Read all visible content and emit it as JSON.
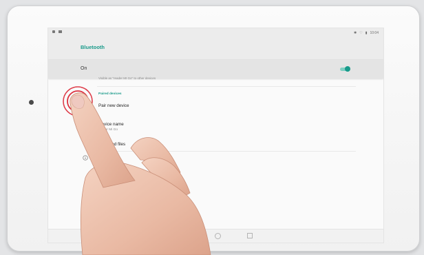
{
  "statusbar": {
    "time": "10:04",
    "status_icons": [
      "bluetooth-icon",
      "wifi-icon",
      "battery-icon"
    ]
  },
  "appbar": {
    "title": "Bluetooth"
  },
  "toggle_row": {
    "label": "On",
    "state": "on"
  },
  "visible_text": "Visible as \"reader MI Go\" to other devices",
  "section": {
    "title": "Paired devices"
  },
  "items": [
    {
      "title": "Pair new device"
    },
    {
      "title": "Device name",
      "subtitle": "reader Mi Go"
    },
    {
      "title": "Received files"
    }
  ],
  "colors": {
    "accent": "#1a9a8a",
    "ripple": "#d81b2a"
  }
}
